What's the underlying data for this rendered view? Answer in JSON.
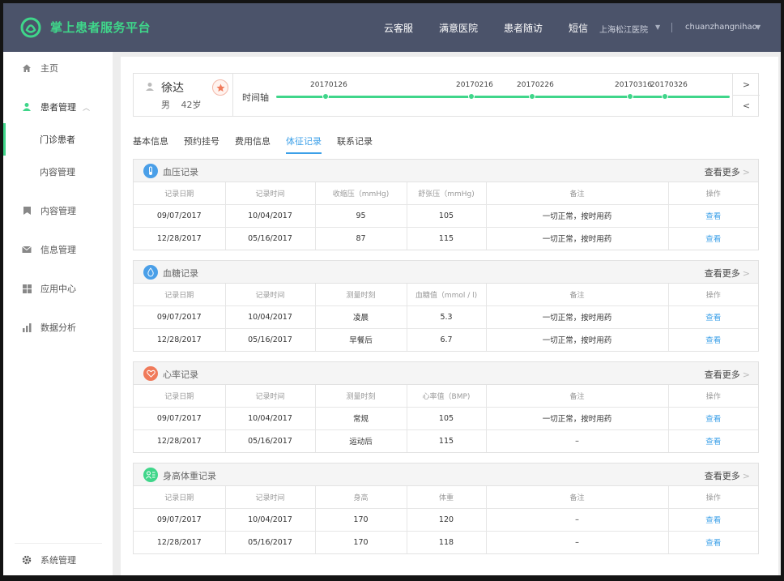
{
  "header": {
    "brand": "掌上患者服务平台",
    "nav": [
      "云客服",
      "满意医院",
      "患者随访",
      "短信"
    ],
    "hospital": "上海松江医院",
    "user": "chuanzhangnihao",
    "brand_color": "#3fd68a",
    "bg_color": "#4b536a"
  },
  "sidebar": {
    "items": [
      {
        "label": "主页",
        "icon": "home-icon"
      },
      {
        "label": "患者管理",
        "icon": "patient-icon"
      },
      {
        "label": "门诊患者"
      },
      {
        "label": "内容管理"
      },
      {
        "label": "内容管理",
        "icon": "bookmark-icon"
      },
      {
        "label": "信息管理",
        "icon": "mail-icon"
      },
      {
        "label": "应用中心",
        "icon": "grid-icon"
      },
      {
        "label": "数据分析",
        "icon": "bar-chart-icon"
      }
    ],
    "footer": {
      "label": "系统管理",
      "icon": "gear-icon"
    }
  },
  "patient": {
    "name": "徐达",
    "gender": "男",
    "age": "42岁",
    "timeline_label": "时间轴",
    "timeline_dates": [
      "20170126",
      "20170216",
      "20170226",
      "20170316",
      "20170326"
    ]
  },
  "tabs": [
    "基本信息",
    "预约挂号",
    "费用信息",
    "体征记录",
    "联系记录"
  ],
  "sections": [
    {
      "title": "血压记录",
      "more": "查看更多",
      "icon": "thermometer-icon",
      "icon_color": "#4a9fe8",
      "headers": [
        "记录日期",
        "记录时间",
        "收缩压（mmHg)",
        "舒张压（mmHg)",
        "备注",
        "操作"
      ],
      "rows": [
        [
          "09/07/2017",
          "10/04/2017",
          "95",
          "105",
          "一切正常，按时用药",
          "查看"
        ],
        [
          "12/28/2017",
          "05/16/2017",
          "87",
          "115",
          "一切正常，按时用药",
          "查看"
        ]
      ]
    },
    {
      "title": "血糖记录",
      "more": "查看更多",
      "icon": "drop-icon",
      "icon_color": "#4a9fe8",
      "headers": [
        "记录日期",
        "记录时间",
        "测量时刻",
        "血糖值（mmol / l)",
        "备注",
        "操作"
      ],
      "rows": [
        [
          "09/07/2017",
          "10/04/2017",
          "凌晨",
          "5.3",
          "一切正常，按时用药",
          "查看"
        ],
        [
          "12/28/2017",
          "05/16/2017",
          "早餐后",
          "6.7",
          "一切正常，按时用药",
          "查看"
        ]
      ]
    },
    {
      "title": "心率记录",
      "more": "查看更多",
      "icon": "heart-icon",
      "icon_color": "#f07a5a",
      "headers": [
        "记录日期",
        "记录时间",
        "测量时刻",
        "心率值（BMP)",
        "备注",
        "操作"
      ],
      "rows": [
        [
          "09/07/2017",
          "10/04/2017",
          "常规",
          "105",
          "一切正常，按时用药",
          "查看"
        ],
        [
          "12/28/2017",
          "05/16/2017",
          "运动后",
          "115",
          "–",
          "查看"
        ]
      ]
    },
    {
      "title": "身高体重记录",
      "more": "查看更多",
      "icon": "scale-icon",
      "icon_color": "#3fd68a",
      "headers": [
        "记录日期",
        "记录时间",
        "身高",
        "体重",
        "备注",
        "操作"
      ],
      "rows": [
        [
          "09/07/2017",
          "10/04/2017",
          "170",
          "120",
          "–",
          "查看"
        ],
        [
          "12/28/2017",
          "05/16/2017",
          "170",
          "118",
          "–",
          "查看"
        ]
      ]
    }
  ]
}
